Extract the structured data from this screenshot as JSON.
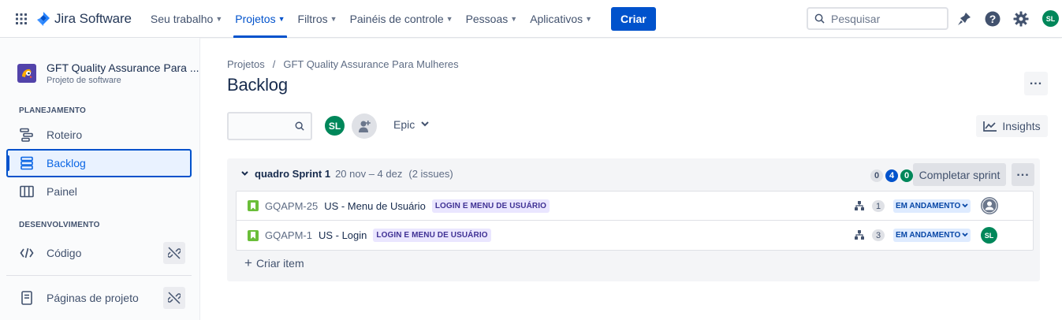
{
  "topnav": {
    "app_name": "Jira Software",
    "menu": [
      {
        "label": "Seu trabalho",
        "active": false
      },
      {
        "label": "Projetos",
        "active": true
      },
      {
        "label": "Filtros",
        "active": false
      },
      {
        "label": "Painéis de controle",
        "active": false
      },
      {
        "label": "Pessoas",
        "active": false
      },
      {
        "label": "Aplicativos",
        "active": false
      }
    ],
    "create_label": "Criar",
    "search_placeholder": "Pesquisar",
    "user_initials": "SL"
  },
  "sidebar": {
    "project_name": "GFT Quality Assurance Para ...",
    "project_type": "Projeto de software",
    "sections": {
      "planning": "PLANEJAMENTO",
      "development": "DESENVOLVIMENTO"
    },
    "items": {
      "roteiro": "Roteiro",
      "backlog": "Backlog",
      "painel": "Painel",
      "codigo": "Código",
      "paginas": "Páginas de projeto"
    }
  },
  "main": {
    "breadcrumb": [
      "Projetos",
      "GFT Quality Assurance Para Mulheres"
    ],
    "breadcrumb_sep": "/",
    "title": "Backlog",
    "filter_avatar_initials": "SL",
    "epic_filter_label": "Epic",
    "insights_label": "Insights"
  },
  "sprint": {
    "name": "quadro Sprint 1",
    "dates": "20 nov – 4 dez",
    "issue_count": "(2 issues)",
    "counts": {
      "todo": "0",
      "in_progress": "4",
      "done": "0"
    },
    "complete_label": "Completar sprint",
    "issues": [
      {
        "key": "GQAPM-25",
        "summary": "US - Menu de Usuário",
        "epic": "LOGIN E MENU DE USUÁRIO",
        "points": "1",
        "status": "EM ANDAMENTO",
        "assignee": ""
      },
      {
        "key": "GQAPM-1",
        "summary": "US - Login",
        "epic": "LOGIN E MENU DE USUÁRIO",
        "points": "3",
        "status": "EM ANDAMENTO",
        "assignee": "SL"
      }
    ],
    "create_issue_label": "Criar item"
  },
  "colors": {
    "primary": "#0052cc",
    "avatar_green": "#00875a",
    "epic_bg": "#eae6ff",
    "status_bg": "#deebff"
  }
}
